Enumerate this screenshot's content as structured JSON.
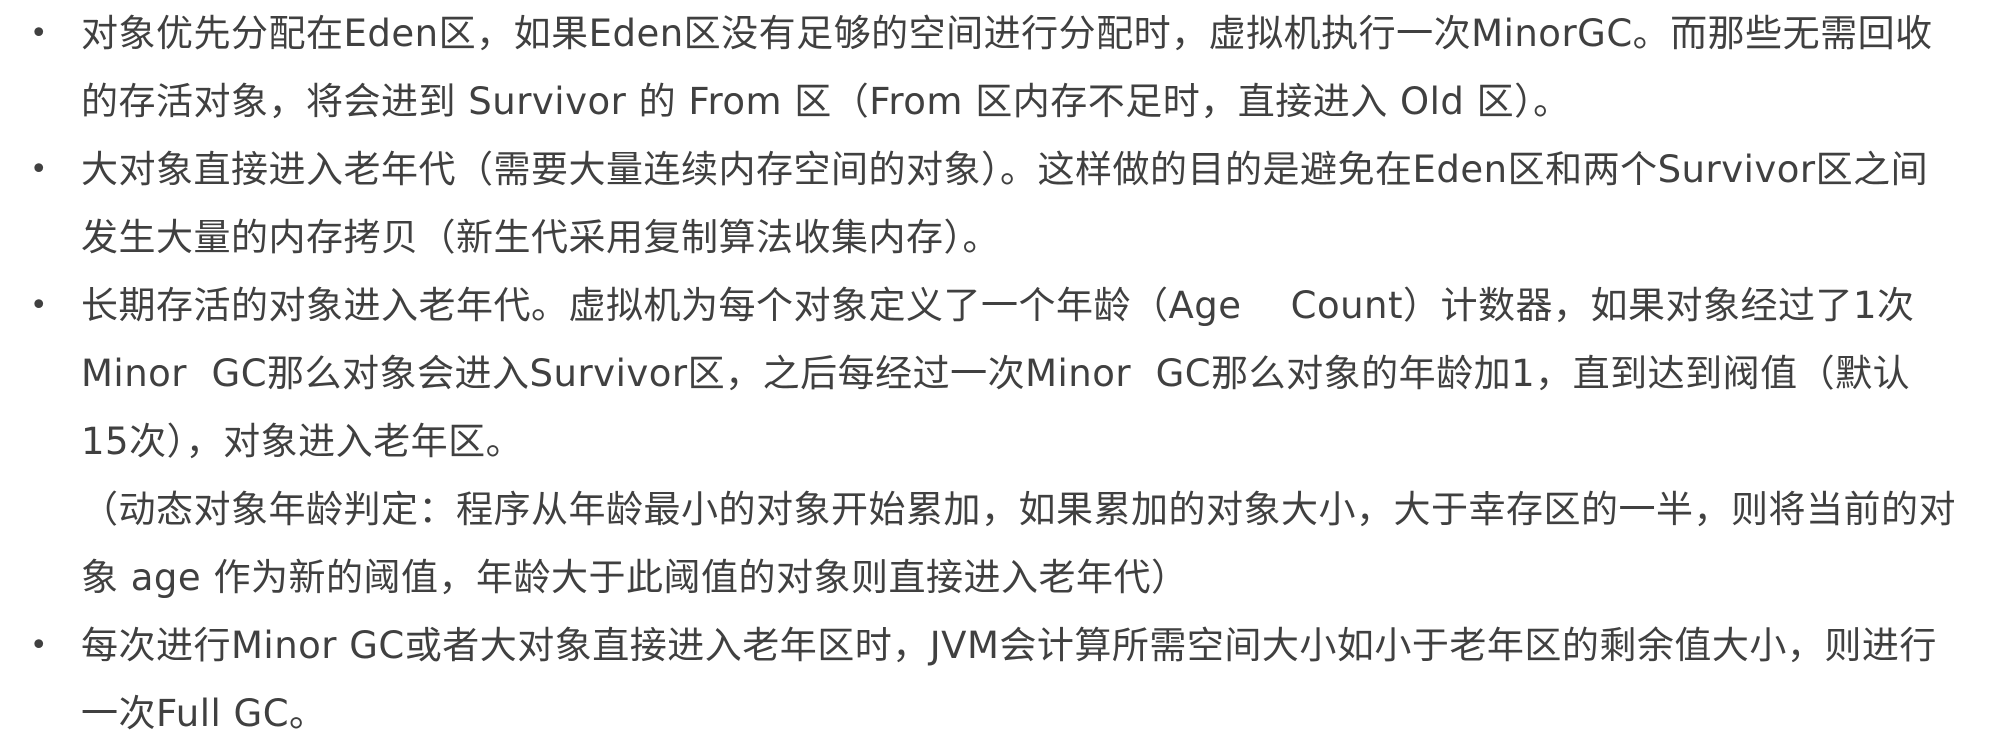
{
  "bullet_glyph": "•",
  "items": [
    {
      "paragraphs": [
        "对象优先分配在Eden区，如果Eden区没有足够的空间进行分配时，虚拟机执行一次MinorGC。而那些无需回收的存活对象，将会进到 Survivor 的 From 区（From 区内存不足时，直接进入 Old 区）。"
      ]
    },
    {
      "paragraphs": [
        "大对象直接进入老年代（需要大量连续内存空间的对象）。这样做的目的是避免在Eden区和两个Survivor区之间发生大量的内存拷贝（新生代采用复制算法收集内存）。"
      ]
    },
    {
      "paragraphs": [
        "长期存活的对象进入老年代。虚拟机为每个对象定义了一个年龄（Age    Count）计数器，如果对象经过了1次Minor  GC那么对象会进入Survivor区，之后每经过一次Minor  GC那么对象的年龄加1，直到达到阀值（默认15次），对象进入老年区。",
        "（动态对象年龄判定：程序从年龄最小的对象开始累加，如果累加的对象大小，大于幸存区的一半，则将当前的对象 age 作为新的阈值，年龄大于此阈值的对象则直接进入老年代）"
      ]
    },
    {
      "paragraphs": [
        "每次进行Minor GC或者大对象直接进入老年区时，JVM会计算所需空间大小如小于老年区的剩余值大小，则进行一次Full GC。"
      ]
    }
  ]
}
